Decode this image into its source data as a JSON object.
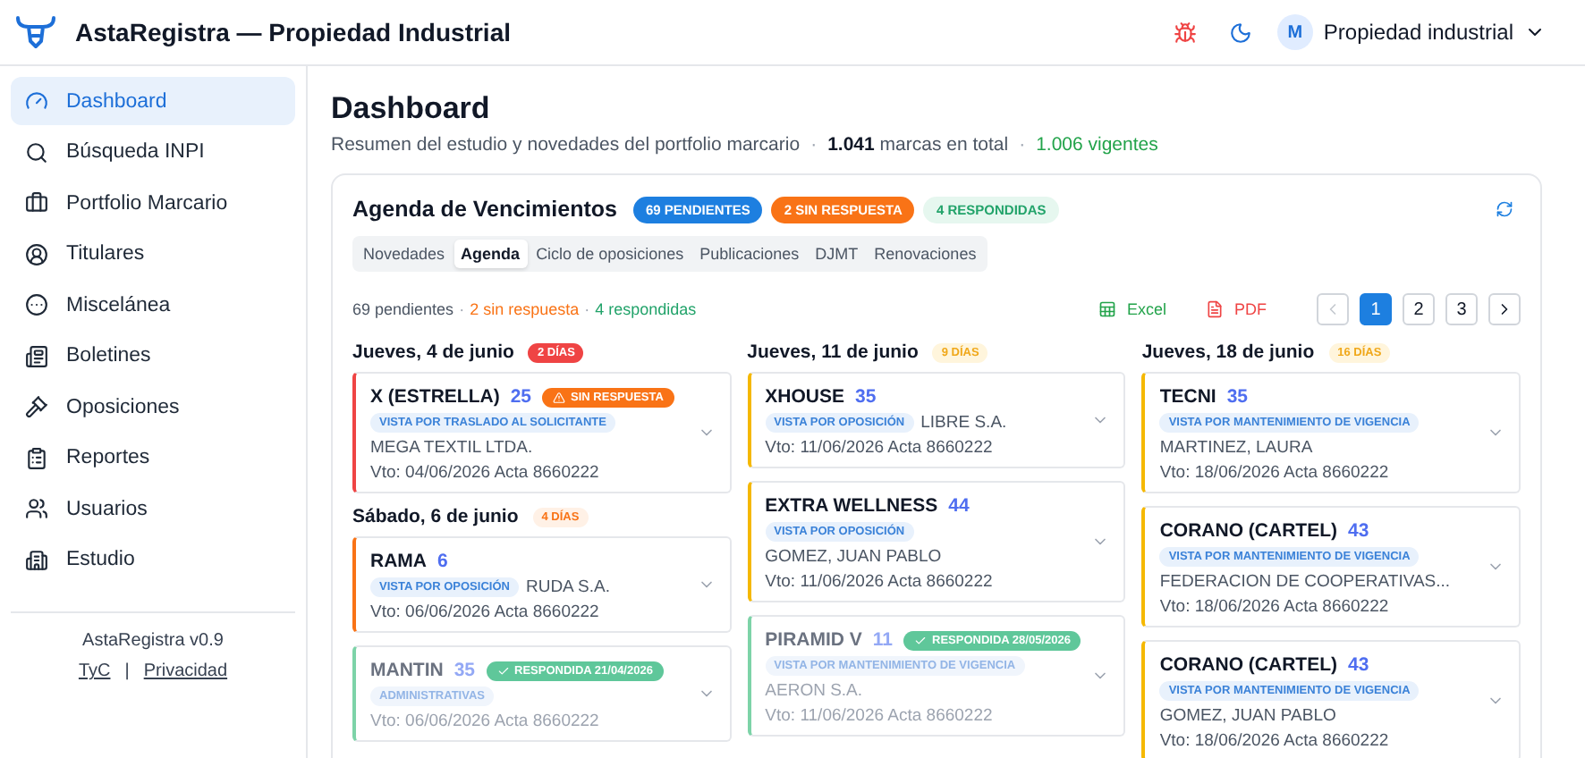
{
  "header": {
    "title": "AstaRegistra — Propiedad Industrial",
    "avatar": "M",
    "account": "Propiedad industrial"
  },
  "sidebar": {
    "items": [
      {
        "label": "Dashboard",
        "selected": true
      },
      {
        "label": "Búsqueda INPI",
        "selected": false
      },
      {
        "label": "Portfolio Marcario",
        "selected": false
      },
      {
        "label": "Titulares",
        "selected": false
      },
      {
        "label": "Miscelánea",
        "selected": false
      },
      {
        "label": "Boletines",
        "selected": false
      },
      {
        "label": "Oposiciones",
        "selected": false
      },
      {
        "label": "Reportes",
        "selected": false
      },
      {
        "label": "Usuarios",
        "selected": false
      },
      {
        "label": "Estudio",
        "selected": false
      }
    ],
    "version": "AstaRegistra v0.9",
    "links": [
      "TyC",
      "Privacidad"
    ],
    "link_separator": "|"
  },
  "page": {
    "title": "Dashboard",
    "subtitle": "Resumen del estudio y novedades del portfolio marcario",
    "separator": "·",
    "stats": [
      {
        "text": "**1.041** marcas en total",
        "kind": "total"
      },
      {
        "text": "1.006 vigentes",
        "kind": "active"
      }
    ]
  },
  "agenda": {
    "title": "Agenda de Vencimientos",
    "pills": [
      {
        "text": "69 PENDIENTES",
        "kind": "pending"
      },
      {
        "text": "2 SIN RESPUESTA",
        "kind": "no_response"
      },
      {
        "text": "4 RESPONDIDAS",
        "kind": "responded"
      }
    ],
    "tabs": [
      {
        "label": "Novedades",
        "selected": false
      },
      {
        "label": "Agenda",
        "selected": true
      },
      {
        "label": "Ciclo de oposiciones",
        "selected": false
      },
      {
        "label": "Publicaciones",
        "selected": false
      },
      {
        "label": "DJMT",
        "selected": false
      },
      {
        "label": "Renovaciones",
        "selected": false
      }
    ],
    "summary": [
      {
        "text": "69 pendientes",
        "kind": "pending"
      },
      {
        "text": "2 sin respuesta",
        "kind": "no_response"
      },
      {
        "text": "4 respondidas",
        "kind": "responded"
      }
    ],
    "separator": "·",
    "exports": [
      {
        "label": "Excel",
        "kind": "excel"
      },
      {
        "label": "PDF",
        "kind": "pdf"
      }
    ],
    "pagination": {
      "prev_disabled": true,
      "pages": [
        {
          "label": "1",
          "selected": true
        },
        {
          "label": "2",
          "selected": false
        },
        {
          "label": "3",
          "selected": false
        }
      ]
    },
    "columns": [
      {
        "groups": [
          {
            "date": "Jueves, 4 de junio",
            "days": "2 DÍAS",
            "kind": "critical",
            "cards": [
              {
                "name": "X (ESTRELLA)",
                "class": "25",
                "responded": false,
                "status": {
                  "kind": "no_response",
                  "text": "SIN RESPUESTA"
                },
                "tag": "VISTA POR TRASLADO AL SOLICITANTE",
                "holder": "MEGA TEXTIL LTDA.",
                "due": "Vto: 04/06/2026 Acta 8660222"
              }
            ]
          },
          {
            "date": "Sábado, 6 de junio",
            "days": "4 DÍAS",
            "kind": "high",
            "cards": [
              {
                "name": "RAMA",
                "class": "6",
                "responded": false,
                "tag": "VISTA POR OPOSICIÓN",
                "holder": "RUDA S.A.",
                "due": "Vto: 06/06/2026 Acta 8660222"
              },
              {
                "name": "MANTIN",
                "class": "35",
                "responded": true,
                "status": {
                  "kind": "responded",
                  "text": "RESPONDIDA 21/04/2026"
                },
                "tag": "ADMINISTRATIVAS",
                "due": "Vto: 06/06/2026 Acta 8660222"
              }
            ]
          }
        ]
      },
      {
        "groups": [
          {
            "date": "Jueves, 11 de junio",
            "days": "9 DÍAS",
            "kind": "medium",
            "cards": [
              {
                "name": "XHOUSE",
                "class": "35",
                "responded": false,
                "tag": "VISTA POR OPOSICIÓN",
                "holder": "LIBRE S.A.",
                "due": "Vto: 11/06/2026 Acta 8660222"
              },
              {
                "name": "EXTRA WELLNESS",
                "class": "44",
                "responded": false,
                "tag": "VISTA POR OPOSICIÓN",
                "holder": "GOMEZ, JUAN PABLO",
                "due": "Vto: 11/06/2026 Acta 8660222"
              },
              {
                "name": "PIRAMID V",
                "class": "11",
                "responded": true,
                "status": {
                  "kind": "responded",
                  "text": "RESPONDIDA 28/05/2026"
                },
                "tag": "VISTA POR MANTENIMIENTO DE VIGENCIA",
                "holder": "AERON S.A.",
                "due": "Vto: 11/06/2026 Acta 8660222"
              }
            ]
          }
        ]
      },
      {
        "groups": [
          {
            "date": "Jueves, 18 de junio",
            "days": "16 DÍAS",
            "kind": "medium",
            "cards": [
              {
                "name": "TECNI",
                "class": "35",
                "responded": false,
                "tag": "VISTA POR MANTENIMIENTO DE VIGENCIA",
                "holder": "MARTINEZ, LAURA",
                "due": "Vto: 18/06/2026 Acta 8660222"
              },
              {
                "name": "CORANO (CARTEL)",
                "class": "43",
                "responded": false,
                "tag": "VISTA POR MANTENIMIENTO DE VIGENCIA",
                "holder": "FEDERACION DE COOPERATIVAS...",
                "due": "Vto: 18/06/2026 Acta 8660222"
              },
              {
                "name": "CORANO (CARTEL)",
                "class": "43",
                "responded": false,
                "tag": "VISTA POR MANTENIMIENTO DE VIGENCIA",
                "holder": "GOMEZ, JUAN PABLO",
                "due": "Vto: 18/06/2026 Acta 8660222"
              }
            ]
          }
        ]
      }
    ]
  }
}
